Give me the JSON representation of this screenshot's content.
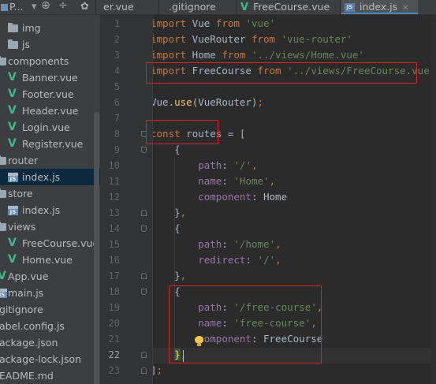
{
  "tabs": {
    "project_label": "P...",
    "items": [
      {
        "label": "er.vue",
        "icon": "vue-icon"
      },
      {
        "label": ".gitignore",
        "icon": "gitignore-icon"
      },
      {
        "label": "FreeCourse.vue",
        "icon": "vue-icon"
      },
      {
        "label": "index.js",
        "icon": "js-icon",
        "active": true
      }
    ]
  },
  "tree": {
    "items": [
      {
        "label": "img",
        "kind": "folder"
      },
      {
        "label": "js",
        "kind": "folder"
      },
      {
        "label": "components",
        "kind": "folder"
      },
      {
        "label": "Banner.vue",
        "kind": "vue"
      },
      {
        "label": "Footer.vue",
        "kind": "vue"
      },
      {
        "label": "Header.vue",
        "kind": "vue"
      },
      {
        "label": "Login.vue",
        "kind": "vue"
      },
      {
        "label": "Register.vue",
        "kind": "vue"
      },
      {
        "label": "router",
        "kind": "folder"
      },
      {
        "label": "index.js",
        "kind": "js",
        "selected": true
      },
      {
        "label": "store",
        "kind": "folder"
      },
      {
        "label": "index.js",
        "kind": "js"
      },
      {
        "label": "views",
        "kind": "folder"
      },
      {
        "label": "FreeCourse.vue",
        "kind": "vue"
      },
      {
        "label": "Home.vue",
        "kind": "vue"
      },
      {
        "label": "App.vue",
        "kind": "vue"
      },
      {
        "label": "main.js",
        "kind": "js"
      },
      {
        "label": "gitignore",
        "kind": "file"
      },
      {
        "label": "abel.config.js",
        "kind": "file"
      },
      {
        "label": "ackage.json",
        "kind": "file"
      },
      {
        "label": "ackage-lock.json",
        "kind": "file"
      },
      {
        "label": "EADME.md",
        "kind": "file"
      }
    ]
  },
  "editor": {
    "current_line": "22",
    "lines": [
      {
        "n": "1",
        "tokens": [
          [
            "kw",
            "import"
          ],
          [
            "plain",
            " Vue "
          ],
          [
            "kw",
            "from"
          ],
          [
            "plain",
            " "
          ],
          [
            "str",
            "'vue'"
          ]
        ]
      },
      {
        "n": "2",
        "tokens": [
          [
            "kw",
            "import"
          ],
          [
            "plain",
            " VueRouter "
          ],
          [
            "kw",
            "from"
          ],
          [
            "plain",
            " "
          ],
          [
            "str",
            "'vue-router'"
          ]
        ]
      },
      {
        "n": "3",
        "tokens": [
          [
            "kw",
            "import"
          ],
          [
            "plain",
            " Home "
          ],
          [
            "kw",
            "from"
          ],
          [
            "plain",
            " "
          ],
          [
            "str",
            "'../views/Home.vue'"
          ]
        ]
      },
      {
        "n": "4",
        "tokens": [
          [
            "kw",
            "import"
          ],
          [
            "plain",
            " FreeCourse "
          ],
          [
            "kw",
            "from"
          ],
          [
            "plain",
            " "
          ],
          [
            "str",
            "'../views/FreeCourse.vue'"
          ]
        ]
      },
      {
        "n": "5",
        "tokens": []
      },
      {
        "n": "6",
        "tokens": [
          [
            "plain",
            "Vue."
          ],
          [
            "fn",
            "use"
          ],
          [
            "plain",
            "(VueRouter)"
          ],
          [
            "punct",
            ";"
          ]
        ]
      },
      {
        "n": "7",
        "tokens": []
      },
      {
        "n": "8",
        "tokens": [
          [
            "kw",
            "const"
          ],
          [
            "plain",
            " routes = ["
          ]
        ]
      },
      {
        "n": "9",
        "tokens": [
          [
            "plain",
            "    {"
          ]
        ]
      },
      {
        "n": "10",
        "tokens": [
          [
            "plain",
            "        "
          ],
          [
            "prop",
            "path"
          ],
          [
            "plain",
            ": "
          ],
          [
            "str",
            "'/'"
          ],
          [
            "punct",
            ","
          ]
        ]
      },
      {
        "n": "11",
        "tokens": [
          [
            "plain",
            "        "
          ],
          [
            "prop",
            "name"
          ],
          [
            "plain",
            ": "
          ],
          [
            "str",
            "'Home'"
          ],
          [
            "punct",
            ","
          ]
        ]
      },
      {
        "n": "12",
        "tokens": [
          [
            "plain",
            "        "
          ],
          [
            "prop",
            "component"
          ],
          [
            "plain",
            ": Home"
          ]
        ]
      },
      {
        "n": "13",
        "tokens": [
          [
            "plain",
            "    }"
          ],
          [
            "punct",
            ","
          ]
        ]
      },
      {
        "n": "14",
        "tokens": [
          [
            "plain",
            "    {"
          ]
        ]
      },
      {
        "n": "15",
        "tokens": [
          [
            "plain",
            "        "
          ],
          [
            "prop",
            "path"
          ],
          [
            "plain",
            ": "
          ],
          [
            "str",
            "'/home'"
          ],
          [
            "punct",
            ","
          ]
        ]
      },
      {
        "n": "16",
        "tokens": [
          [
            "plain",
            "        "
          ],
          [
            "prop",
            "redirect"
          ],
          [
            "plain",
            ": "
          ],
          [
            "str",
            "'/'"
          ],
          [
            "punct",
            ","
          ]
        ]
      },
      {
        "n": "17",
        "tokens": [
          [
            "plain",
            "    }"
          ],
          [
            "punct",
            ","
          ]
        ]
      },
      {
        "n": "18",
        "tokens": [
          [
            "plain",
            "    {"
          ]
        ]
      },
      {
        "n": "19",
        "tokens": [
          [
            "plain",
            "        "
          ],
          [
            "prop",
            "path"
          ],
          [
            "plain",
            ": "
          ],
          [
            "str",
            "'/free-course'"
          ],
          [
            "punct",
            ","
          ]
        ]
      },
      {
        "n": "20",
        "tokens": [
          [
            "plain",
            "        "
          ],
          [
            "prop",
            "name"
          ],
          [
            "plain",
            ": "
          ],
          [
            "str",
            "'free-course'"
          ],
          [
            "punct",
            ","
          ]
        ]
      },
      {
        "n": "21",
        "tokens": [
          [
            "plain",
            "        "
          ],
          [
            "prop",
            "component"
          ],
          [
            "plain",
            ": FreeCourse"
          ]
        ]
      },
      {
        "n": "22",
        "tokens": [
          [
            "plain",
            "    "
          ],
          [
            "hl",
            "}"
          ],
          [
            "punct",
            ","
          ]
        ]
      },
      {
        "n": "23",
        "tokens": [
          [
            "plain",
            "]"
          ],
          [
            "punct",
            ";"
          ]
        ]
      }
    ]
  },
  "colors": {
    "annotation_box": "#e0201c",
    "keyword": "#cc7832",
    "string": "#6a8759",
    "property": "#9876aa",
    "function": "#ffc66d",
    "vue_green": "#41b883"
  }
}
